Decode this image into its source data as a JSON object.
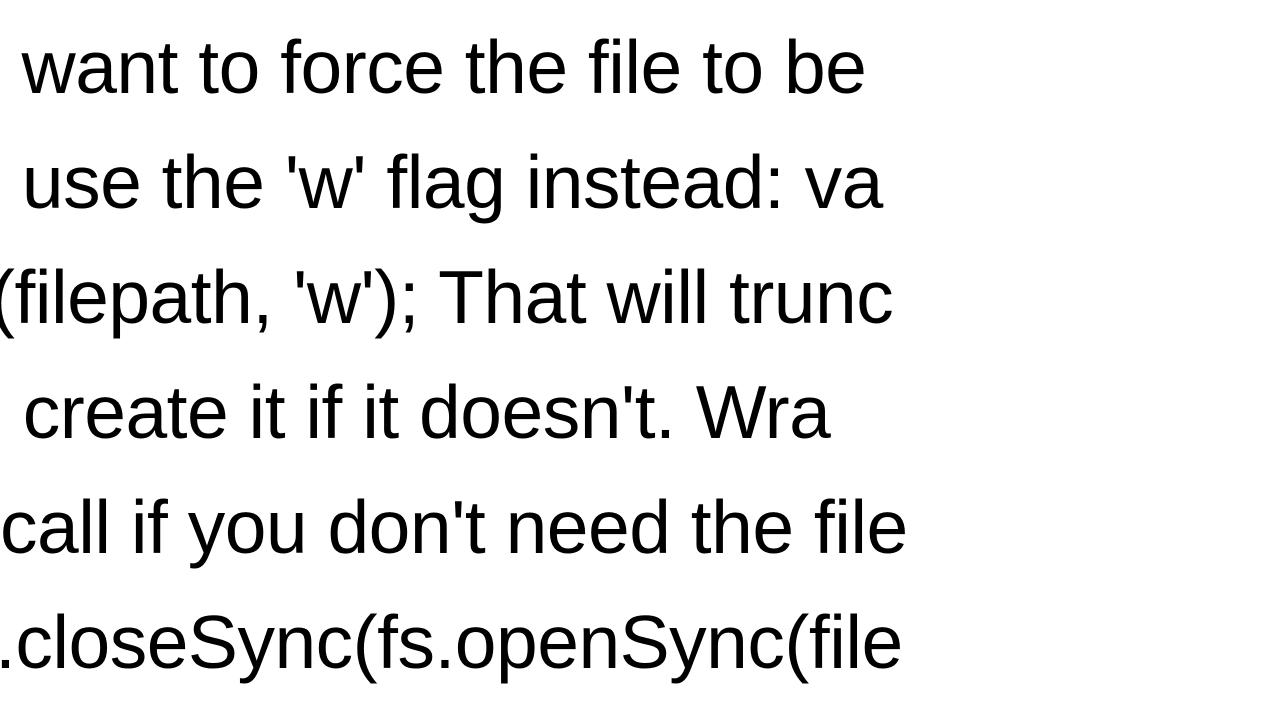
{
  "content": {
    "line1": "u want to force the file to be",
    "line2": "to use the 'w' flag instead: va",
    "line3": "(filepath, 'w');  That will trunc",
    "line4": "nd create it if it doesn't. Wra",
    "line5": " call if you don't need the file",
    "line6": ".closeSync(fs.openSync(file"
  }
}
